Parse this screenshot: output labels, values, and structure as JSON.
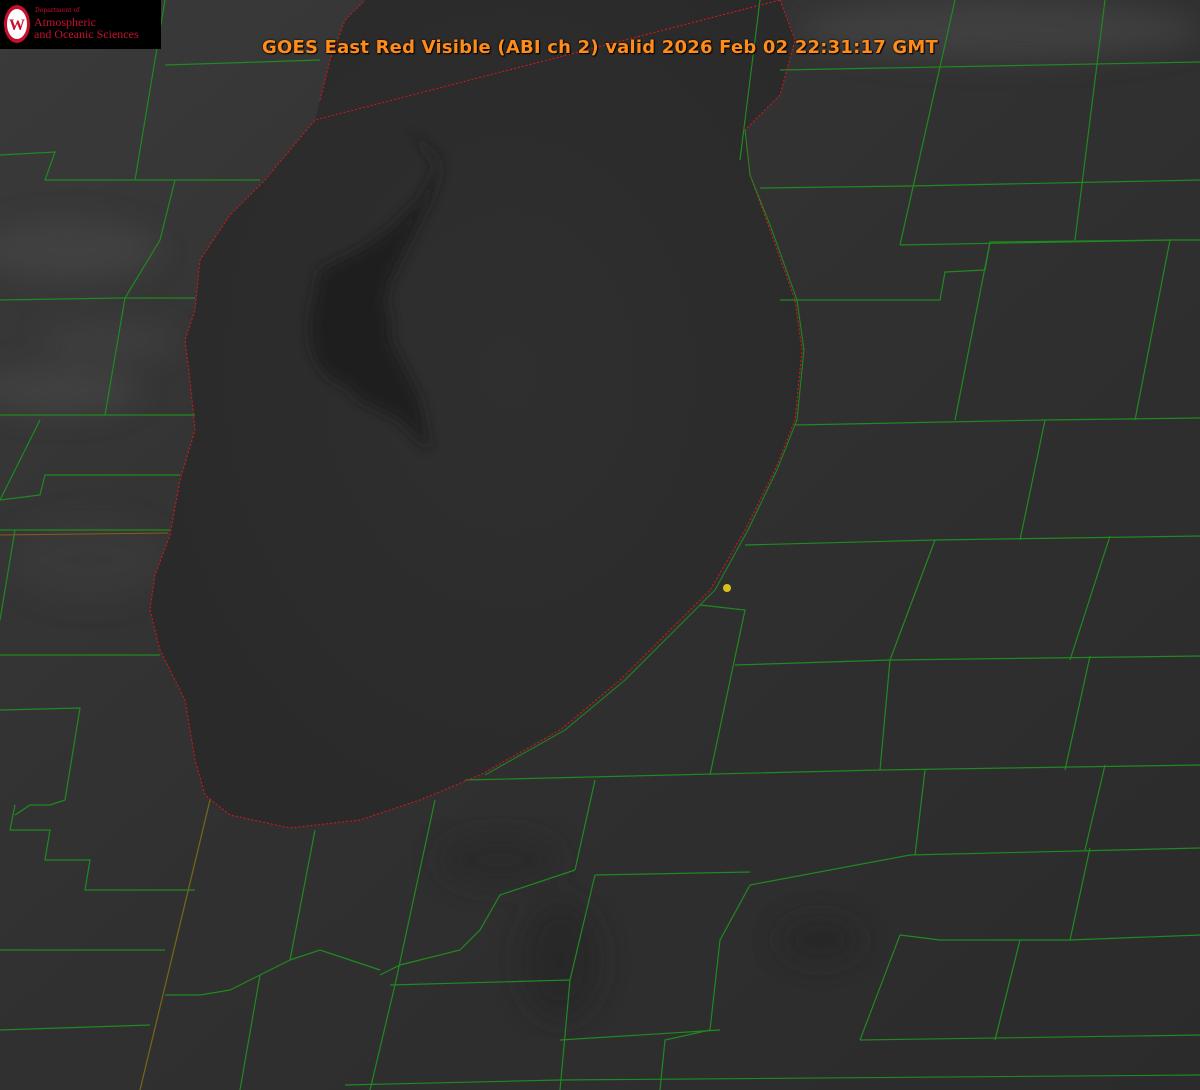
{
  "title": "GOES East Red Visible (ABI ch 2) valid 2026 Feb 02 22:31:17 GMT",
  "logo": {
    "department": "Department of",
    "line1": "Atmospheric",
    "line2": "and Oceanic Sciences",
    "seal_letter": "W"
  },
  "colors": {
    "title": "#ff8c1a",
    "county_lines": "#1f8a1f",
    "shoreline": "#d01818",
    "marker": "#d6c21a",
    "logo_red": "#c8102e"
  }
}
